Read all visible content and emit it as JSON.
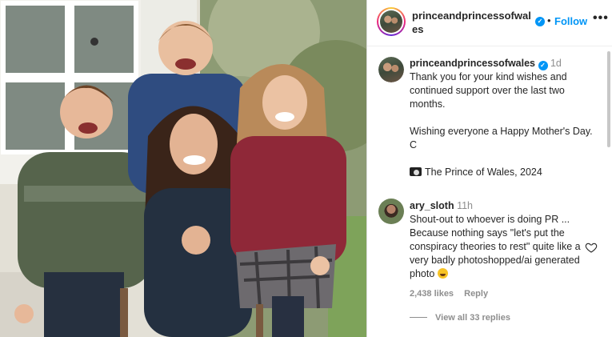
{
  "photo": {
    "alt": ""
  },
  "header": {
    "username": "princeandprincessofwales",
    "verified_icon": "verified-badge-icon",
    "follow_label": "Follow",
    "separator": "•",
    "more_label": "•••"
  },
  "caption": {
    "username": "princeandprincessofwales",
    "time": "1d",
    "line1": "Thank you for your kind wishes and continued support over the last two months.",
    "line2": "Wishing everyone a Happy Mother's Day. C",
    "line3": "The Prince of Wales, 2024",
    "camera_icon": "camera-emoji"
  },
  "reply": {
    "username": "ary_sloth",
    "time": "11h",
    "text": "Shout-out to whoever is doing PR ... Because nothing says \"let's put the conspiracy theories to rest\" quite like a very badly photoshopped/ai generated photo",
    "emoji": "laughing-crying-emoji",
    "likes": "2,438 likes",
    "reply_label": "Reply",
    "heart_icon": "heart-outline-icon"
  },
  "view_all": "View all 33 replies",
  "colors": {
    "accent": "#0095f6",
    "muted": "#8e8e8e",
    "text": "#262626"
  }
}
